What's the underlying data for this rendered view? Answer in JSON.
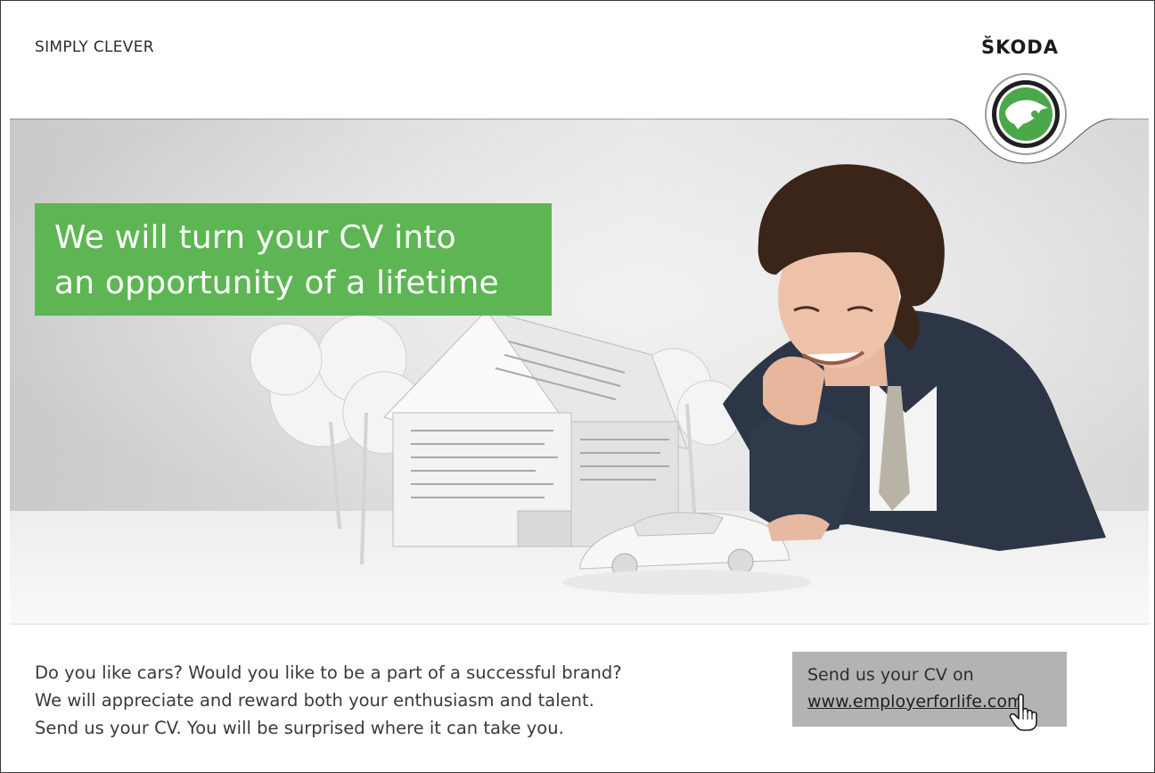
{
  "header": {
    "tagline": "SIMPLY CLEVER",
    "brand": "ŠKODA",
    "logo_icon": "skoda-winged-arrow-logo"
  },
  "hero": {
    "headline_lines": [
      "We will turn your CV into",
      "an opportunity of a lifetime"
    ],
    "headline_bg": "#5db653"
  },
  "body": {
    "lines": [
      "Do you like cars? Would you like to be a part of a successful brand?",
      "We will appreciate and reward both your enthusiasm and talent.",
      "Send us your CV. You will be surprised where it can take you."
    ]
  },
  "cta": {
    "prefix": "Send us your CV on",
    "link": "www.employerforlife.com",
    "bg": "#b3b3b3",
    "cursor_icon": "hand-pointer-icon"
  }
}
